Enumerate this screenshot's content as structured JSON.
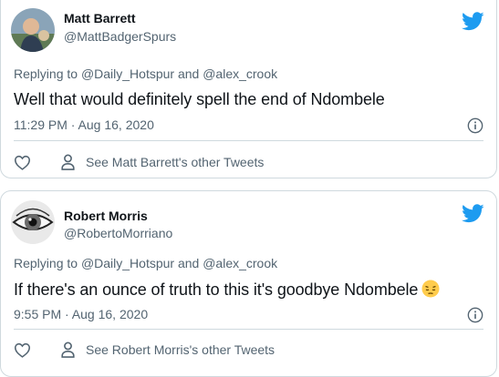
{
  "tweets": [
    {
      "name": "Matt Barrett",
      "handle": "@MattBadgerSpurs",
      "replying_prefix": "Replying to",
      "mention1": "@Daily_Hotspur",
      "and_word": "and",
      "mention2": "@alex_crook",
      "text": "Well that would definitely spell the end of Ndombele",
      "timestamp": "11:29 PM · Aug 16, 2020",
      "other_tweets": "See Matt Barrett's other Tweets"
    },
    {
      "name": "Robert Morris",
      "handle": "@RobertoMorriano",
      "replying_prefix": "Replying to",
      "mention1": "@Daily_Hotspur",
      "and_word": "and",
      "mention2": "@alex_crook",
      "text": "If there's an ounce of truth to this it's goodbye Ndombele",
      "timestamp": "9:55 PM · Aug 16, 2020",
      "other_tweets": "See Robert Morris's other Tweets",
      "emoji": "pensive-face"
    }
  ],
  "colors": {
    "twitter_blue": "#1d9bf0",
    "secondary_text": "#536471",
    "border": "#cfd9de"
  }
}
